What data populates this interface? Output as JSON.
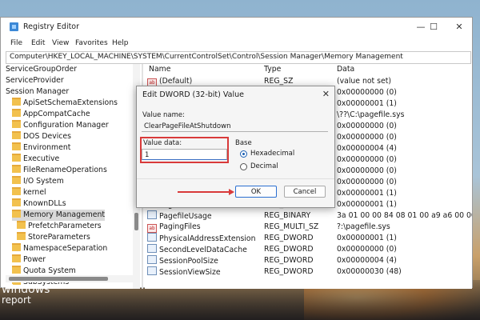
{
  "window": {
    "title": "Registry Editor",
    "controls": {
      "minimize": "—",
      "maximize": "☐",
      "close": "✕"
    }
  },
  "menu": [
    "File",
    "Edit",
    "View",
    "Favorites",
    "Help"
  ],
  "address": "Computer\\HKEY_LOCAL_MACHINE\\SYSTEM\\CurrentControlSet\\Control\\Session Manager\\Memory Management",
  "tree": {
    "items": [
      {
        "label": "ServiceGroupOrder",
        "folder": false
      },
      {
        "label": "ServiceProvider",
        "folder": false
      },
      {
        "label": "Session Manager",
        "folder": false
      },
      {
        "label": "ApiSetSchemaExtensions",
        "folder": true
      },
      {
        "label": "AppCompatCache",
        "folder": true
      },
      {
        "label": "Configuration Manager",
        "folder": true
      },
      {
        "label": "DOS Devices",
        "folder": true
      },
      {
        "label": "Environment",
        "folder": true
      },
      {
        "label": "Executive",
        "folder": true
      },
      {
        "label": "FileRenameOperations",
        "folder": true
      },
      {
        "label": "I/O System",
        "folder": true
      },
      {
        "label": "kernel",
        "folder": true
      },
      {
        "label": "KnownDLLs",
        "folder": true
      },
      {
        "label": "Memory Management",
        "folder": true,
        "selected": true
      },
      {
        "label": "PrefetchParameters",
        "folder": true
      },
      {
        "label": "StoreParameters",
        "folder": true
      },
      {
        "label": "NamespaceSeparation",
        "folder": true
      },
      {
        "label": "Power",
        "folder": true
      },
      {
        "label": "Quota System",
        "folder": true
      },
      {
        "label": "SubSystems",
        "folder": true
      }
    ]
  },
  "list": {
    "headers": {
      "name": "Name",
      "type": "Type",
      "data": "Data"
    },
    "rows": [
      {
        "name": "(Default)",
        "type": "REG_SZ",
        "data": "(value not set)",
        "icon": "ab"
      },
      {
        "name": "",
        "type": "",
        "data": "0x00000000 (0)",
        "icon": ""
      },
      {
        "name": "",
        "type": "",
        "data": "0x00000001 (1)",
        "icon": ""
      },
      {
        "name": "",
        "type": "",
        "data": "\\??\\C:\\pagefile.sys",
        "icon": ""
      },
      {
        "name": "",
        "type": "",
        "data": "0x00000000 (0)",
        "icon": ""
      },
      {
        "name": "",
        "type": "",
        "data": "0x00000000 (0)",
        "icon": ""
      },
      {
        "name": "",
        "type": "",
        "data": "0x00000004 (4)",
        "icon": ""
      },
      {
        "name": "",
        "type": "",
        "data": "0x00000000 (0)",
        "icon": ""
      },
      {
        "name": "",
        "type": "",
        "data": "0x00000000 (0)",
        "icon": ""
      },
      {
        "name": "",
        "type": "",
        "data": "0x00000000 (0)",
        "icon": ""
      },
      {
        "name": "",
        "type": "",
        "data": "0x00000001 (1)",
        "icon": ""
      },
      {
        "name": "PagefileOnOsVolume",
        "type": "REG_DWORD",
        "data": "0x00000001 (1)",
        "icon": "dw"
      },
      {
        "name": "PagefileUsage",
        "type": "REG_BINARY",
        "data": "3a 01 00 00 84 08 01 00 a9 a6 00 00 50",
        "icon": "dw"
      },
      {
        "name": "PagingFiles",
        "type": "REG_MULTI_SZ",
        "data": "?:\\pagefile.sys",
        "icon": "ab"
      },
      {
        "name": "PhysicalAddressExtension",
        "type": "REG_DWORD",
        "data": "0x00000001 (1)",
        "icon": "dw"
      },
      {
        "name": "SecondLevelDataCache",
        "type": "REG_DWORD",
        "data": "0x00000000 (0)",
        "icon": "dw"
      },
      {
        "name": "SessionPoolSize",
        "type": "REG_DWORD",
        "data": "0x00000004 (4)",
        "icon": "dw"
      },
      {
        "name": "SessionViewSize",
        "type": "REG_DWORD",
        "data": "0x00000030 (48)",
        "icon": "dw"
      }
    ]
  },
  "dialog": {
    "title": "Edit DWORD (32-bit) Value",
    "close": "✕",
    "value_name_label": "Value name:",
    "value_name": "ClearPageFileAtShutdown",
    "value_data_label": "Value data:",
    "value_data": "1",
    "base_label": "Base",
    "hex_label": "Hexadecimal",
    "dec_label": "Decimal",
    "selected_base": "Hexadecimal",
    "ok": "OK",
    "cancel": "Cancel"
  },
  "watermark": {
    "line1": "windows",
    "line2": "report"
  },
  "colors": {
    "highlight": "#d93a3a",
    "accent": "#1a5fb4"
  }
}
